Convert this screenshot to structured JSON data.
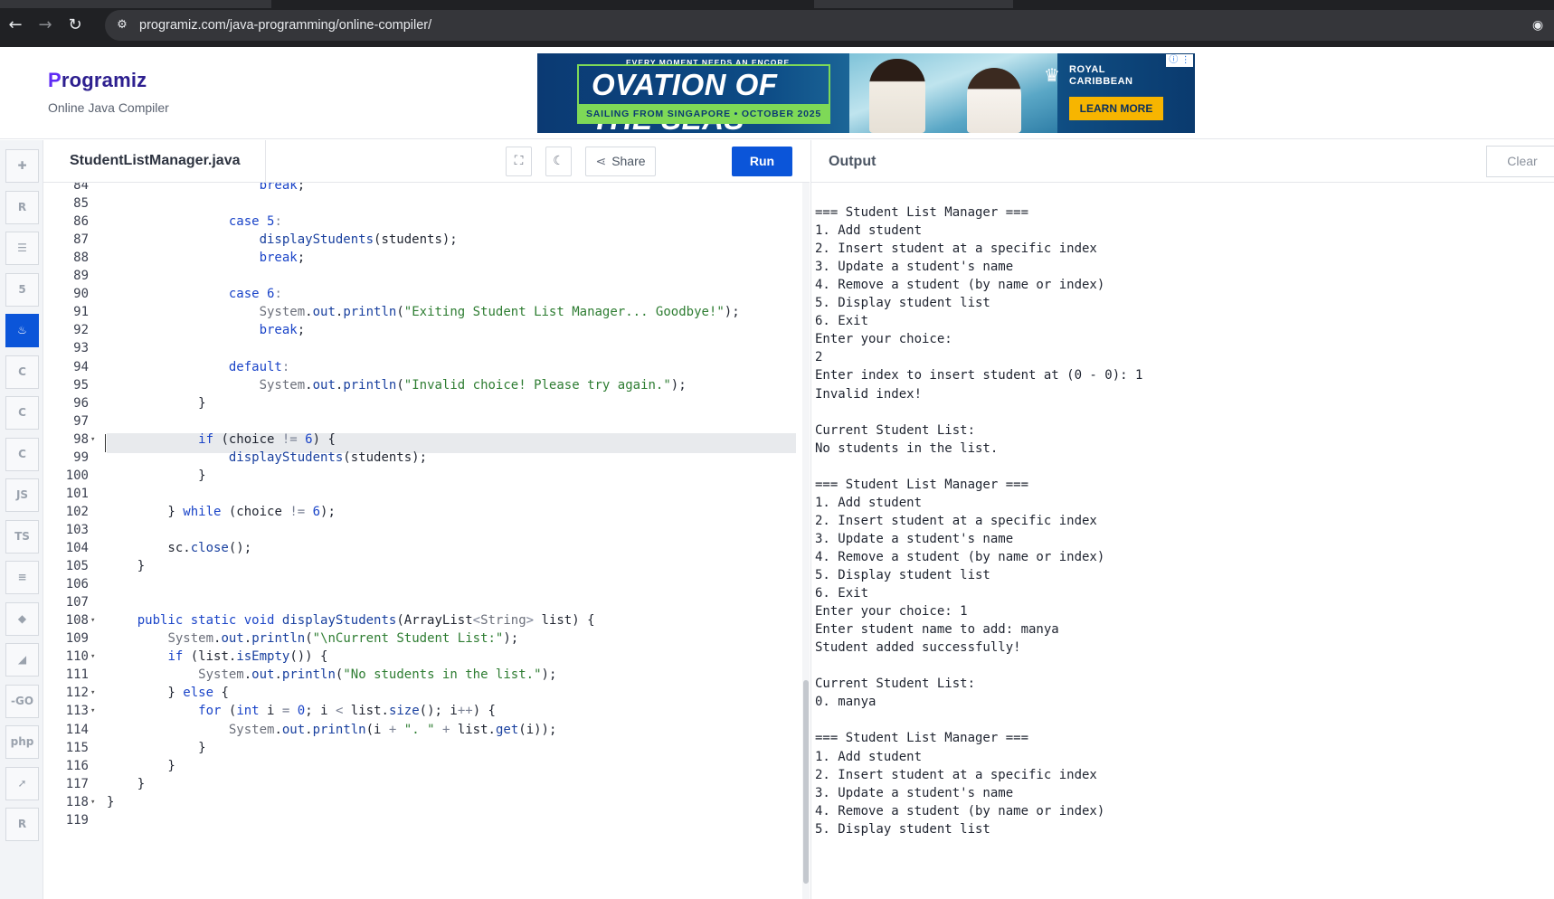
{
  "browser": {
    "url": "programiz.com/java-programming/online-compiler/",
    "back_icon": "←",
    "forward_icon": "→",
    "reload_icon": "↻",
    "site_info_icon": "⚙",
    "tracking_icon": "◉"
  },
  "header": {
    "logo_first": "P",
    "logo_rest": "rogramiz",
    "subtitle": "Online Java Compiler"
  },
  "ad": {
    "kicker": "EVERY MOMENT NEEDS AN ENCORE",
    "headline": "OVATION OF THE SEAS",
    "tagline": "SAILING FROM SINGAPORE • OCTOBER 2025",
    "brand_line1": "ROYAL",
    "brand_line2": "CARIBBEAN",
    "cta": "LEARN MORE",
    "adinfo": "ⓘ ⋮"
  },
  "sidebar": {
    "languages": [
      {
        "name": "python",
        "glyph": "✚"
      },
      {
        "name": "r",
        "glyph": "R"
      },
      {
        "name": "sql",
        "glyph": "☰"
      },
      {
        "name": "html",
        "glyph": "5"
      },
      {
        "name": "java",
        "glyph": "♨"
      },
      {
        "name": "c",
        "glyph": "C"
      },
      {
        "name": "cpp",
        "glyph": "C"
      },
      {
        "name": "csharp",
        "glyph": "C"
      },
      {
        "name": "javascript",
        "glyph": "JS"
      },
      {
        "name": "typescript",
        "glyph": "TS"
      },
      {
        "name": "kotlin",
        "glyph": "≡"
      },
      {
        "name": "ruby",
        "glyph": "◆"
      },
      {
        "name": "dart",
        "glyph": "◢"
      },
      {
        "name": "go",
        "glyph": "-GO"
      },
      {
        "name": "php",
        "glyph": "php"
      },
      {
        "name": "swift",
        "glyph": "➚"
      },
      {
        "name": "rust",
        "glyph": "R"
      }
    ],
    "active": "java"
  },
  "editor": {
    "filename": "StudentListManager.java",
    "fullscreen_icon": "⛶",
    "theme_icon": "☾",
    "share_icon": "⋖",
    "share_label": "Share",
    "run_label": "Run",
    "lines": [
      {
        "n": "84",
        "fold": ""
      },
      {
        "n": "85",
        "fold": ""
      },
      {
        "n": "86",
        "fold": ""
      },
      {
        "n": "87",
        "fold": ""
      },
      {
        "n": "88",
        "fold": ""
      },
      {
        "n": "89",
        "fold": ""
      },
      {
        "n": "90",
        "fold": ""
      },
      {
        "n": "91",
        "fold": ""
      },
      {
        "n": "92",
        "fold": ""
      },
      {
        "n": "93",
        "fold": ""
      },
      {
        "n": "94",
        "fold": ""
      },
      {
        "n": "95",
        "fold": ""
      },
      {
        "n": "96",
        "fold": ""
      },
      {
        "n": "97",
        "fold": ""
      },
      {
        "n": "98",
        "fold": "▾"
      },
      {
        "n": "99",
        "fold": ""
      },
      {
        "n": "100",
        "fold": ""
      },
      {
        "n": "101",
        "fold": ""
      },
      {
        "n": "102",
        "fold": ""
      },
      {
        "n": "103",
        "fold": ""
      },
      {
        "n": "104",
        "fold": ""
      },
      {
        "n": "105",
        "fold": ""
      },
      {
        "n": "106",
        "fold": ""
      },
      {
        "n": "107",
        "fold": ""
      },
      {
        "n": "108",
        "fold": "▾"
      },
      {
        "n": "109",
        "fold": ""
      },
      {
        "n": "110",
        "fold": "▾"
      },
      {
        "n": "111",
        "fold": ""
      },
      {
        "n": "112",
        "fold": "▾"
      },
      {
        "n": "113",
        "fold": "▾"
      },
      {
        "n": "114",
        "fold": ""
      },
      {
        "n": "115",
        "fold": ""
      },
      {
        "n": "116",
        "fold": ""
      },
      {
        "n": "117",
        "fold": ""
      },
      {
        "n": "118",
        "fold": "▾"
      },
      {
        "n": "119",
        "fold": ""
      }
    ],
    "code": [
      [
        {
          "t": "                    "
        },
        {
          "t": "break",
          "c": "kw"
        },
        {
          "t": ";"
        }
      ],
      [],
      [
        {
          "t": "                "
        },
        {
          "t": "case",
          "c": "kw"
        },
        {
          "t": " "
        },
        {
          "t": "5",
          "c": "num"
        },
        {
          "t": ":",
          "c": "op"
        }
      ],
      [
        {
          "t": "                    "
        },
        {
          "t": "displayStudents",
          "c": "fn"
        },
        {
          "t": "(students);"
        }
      ],
      [
        {
          "t": "                    "
        },
        {
          "t": "break",
          "c": "kw"
        },
        {
          "t": ";"
        }
      ],
      [],
      [
        {
          "t": "                "
        },
        {
          "t": "case",
          "c": "kw"
        },
        {
          "t": " "
        },
        {
          "t": "6",
          "c": "num"
        },
        {
          "t": ":",
          "c": "op"
        }
      ],
      [
        {
          "t": "                    "
        },
        {
          "t": "System",
          "c": "cls"
        },
        {
          "t": "."
        },
        {
          "t": "out",
          "c": "fn"
        },
        {
          "t": "."
        },
        {
          "t": "println",
          "c": "fn"
        },
        {
          "t": "("
        },
        {
          "t": "\"Exiting Student List Manager... Goodbye!\"",
          "c": "str"
        },
        {
          "t": ");"
        }
      ],
      [
        {
          "t": "                    "
        },
        {
          "t": "break",
          "c": "kw"
        },
        {
          "t": ";"
        }
      ],
      [],
      [
        {
          "t": "                "
        },
        {
          "t": "default",
          "c": "kw"
        },
        {
          "t": ":",
          "c": "op"
        }
      ],
      [
        {
          "t": "                    "
        },
        {
          "t": "System",
          "c": "cls"
        },
        {
          "t": "."
        },
        {
          "t": "out",
          "c": "fn"
        },
        {
          "t": "."
        },
        {
          "t": "println",
          "c": "fn"
        },
        {
          "t": "("
        },
        {
          "t": "\"Invalid choice! Please try again.\"",
          "c": "str"
        },
        {
          "t": ");"
        }
      ],
      [
        {
          "t": "            }"
        }
      ],
      [],
      [
        {
          "t": "            "
        },
        {
          "t": "if",
          "c": "kw"
        },
        {
          "t": " (choice "
        },
        {
          "t": "!=",
          "c": "op"
        },
        {
          "t": " "
        },
        {
          "t": "6",
          "c": "num"
        },
        {
          "t": ") {"
        }
      ],
      [
        {
          "t": "                "
        },
        {
          "t": "displayStudents",
          "c": "fn"
        },
        {
          "t": "(students);"
        }
      ],
      [
        {
          "t": "            }"
        }
      ],
      [],
      [
        {
          "t": "        } "
        },
        {
          "t": "while",
          "c": "kw"
        },
        {
          "t": " (choice "
        },
        {
          "t": "!=",
          "c": "op"
        },
        {
          "t": " "
        },
        {
          "t": "6",
          "c": "num"
        },
        {
          "t": ");"
        }
      ],
      [],
      [
        {
          "t": "        sc."
        },
        {
          "t": "close",
          "c": "fn"
        },
        {
          "t": "();"
        }
      ],
      [
        {
          "t": "    }"
        }
      ],
      [],
      [],
      [
        {
          "t": "    "
        },
        {
          "t": "public",
          "c": "kw"
        },
        {
          "t": " "
        },
        {
          "t": "static",
          "c": "kw"
        },
        {
          "t": " "
        },
        {
          "t": "void",
          "c": "kw"
        },
        {
          "t": " "
        },
        {
          "t": "displayStudents",
          "c": "fn"
        },
        {
          "t": "(ArrayList"
        },
        {
          "t": "<",
          "c": "op"
        },
        {
          "t": "String",
          "c": "cls"
        },
        {
          "t": ">",
          "c": "op"
        },
        {
          "t": " list) {"
        }
      ],
      [
        {
          "t": "        "
        },
        {
          "t": "System",
          "c": "cls"
        },
        {
          "t": "."
        },
        {
          "t": "out",
          "c": "fn"
        },
        {
          "t": "."
        },
        {
          "t": "println",
          "c": "fn"
        },
        {
          "t": "("
        },
        {
          "t": "\"\\nCurrent Student List:\"",
          "c": "str"
        },
        {
          "t": ");"
        }
      ],
      [
        {
          "t": "        "
        },
        {
          "t": "if",
          "c": "kw"
        },
        {
          "t": " (list."
        },
        {
          "t": "isEmpty",
          "c": "fn"
        },
        {
          "t": "()) {"
        }
      ],
      [
        {
          "t": "            "
        },
        {
          "t": "System",
          "c": "cls"
        },
        {
          "t": "."
        },
        {
          "t": "out",
          "c": "fn"
        },
        {
          "t": "."
        },
        {
          "t": "println",
          "c": "fn"
        },
        {
          "t": "("
        },
        {
          "t": "\"No students in the list.\"",
          "c": "str"
        },
        {
          "t": ");"
        }
      ],
      [
        {
          "t": "        } "
        },
        {
          "t": "else",
          "c": "kw"
        },
        {
          "t": " {"
        }
      ],
      [
        {
          "t": "            "
        },
        {
          "t": "for",
          "c": "kw"
        },
        {
          "t": " ("
        },
        {
          "t": "int",
          "c": "kw"
        },
        {
          "t": " i "
        },
        {
          "t": "=",
          "c": "op"
        },
        {
          "t": " "
        },
        {
          "t": "0",
          "c": "num"
        },
        {
          "t": "; i "
        },
        {
          "t": "<",
          "c": "op"
        },
        {
          "t": " list."
        },
        {
          "t": "size",
          "c": "fn"
        },
        {
          "t": "(); i"
        },
        {
          "t": "++",
          "c": "op"
        },
        {
          "t": ") {"
        }
      ],
      [
        {
          "t": "                "
        },
        {
          "t": "System",
          "c": "cls"
        },
        {
          "t": "."
        },
        {
          "t": "out",
          "c": "fn"
        },
        {
          "t": "."
        },
        {
          "t": "println",
          "c": "fn"
        },
        {
          "t": "(i "
        },
        {
          "t": "+",
          "c": "op"
        },
        {
          "t": " "
        },
        {
          "t": "\". \"",
          "c": "str"
        },
        {
          "t": " "
        },
        {
          "t": "+",
          "c": "op"
        },
        {
          "t": " list."
        },
        {
          "t": "get",
          "c": "fn"
        },
        {
          "t": "(i));"
        }
      ],
      [
        {
          "t": "            }"
        }
      ],
      [
        {
          "t": "        }"
        }
      ],
      [
        {
          "t": "    }"
        }
      ],
      [
        {
          "t": "}"
        }
      ],
      []
    ]
  },
  "output": {
    "title": "Output",
    "clear_label": "Clear",
    "lines": [
      "=== Student List Manager ===",
      "1. Add student",
      "2. Insert student at a specific index",
      "3. Update a student's name",
      "4. Remove a student (by name or index)",
      "5. Display student list",
      "6. Exit",
      "Enter your choice:",
      "2",
      "Enter index to insert student at (0 - 0): 1",
      "Invalid index!",
      "",
      "Current Student List:",
      "No students in the list.",
      "",
      "=== Student List Manager ===",
      "1. Add student",
      "2. Insert student at a specific index",
      "3. Update a student's name",
      "4. Remove a student (by name or index)",
      "5. Display student list",
      "6. Exit",
      "Enter your choice: 1",
      "Enter student name to add: manya",
      "Student added successfully!",
      "",
      "Current Student List:",
      "0. manya",
      "",
      "=== Student List Manager ===",
      "1. Add student",
      "2. Insert student at a specific index",
      "3. Update a student's name",
      "4. Remove a student (by name or index)",
      "5. Display student list"
    ]
  },
  "colors": {
    "run": "#0b55d9",
    "logo": "#5f2cf5"
  }
}
